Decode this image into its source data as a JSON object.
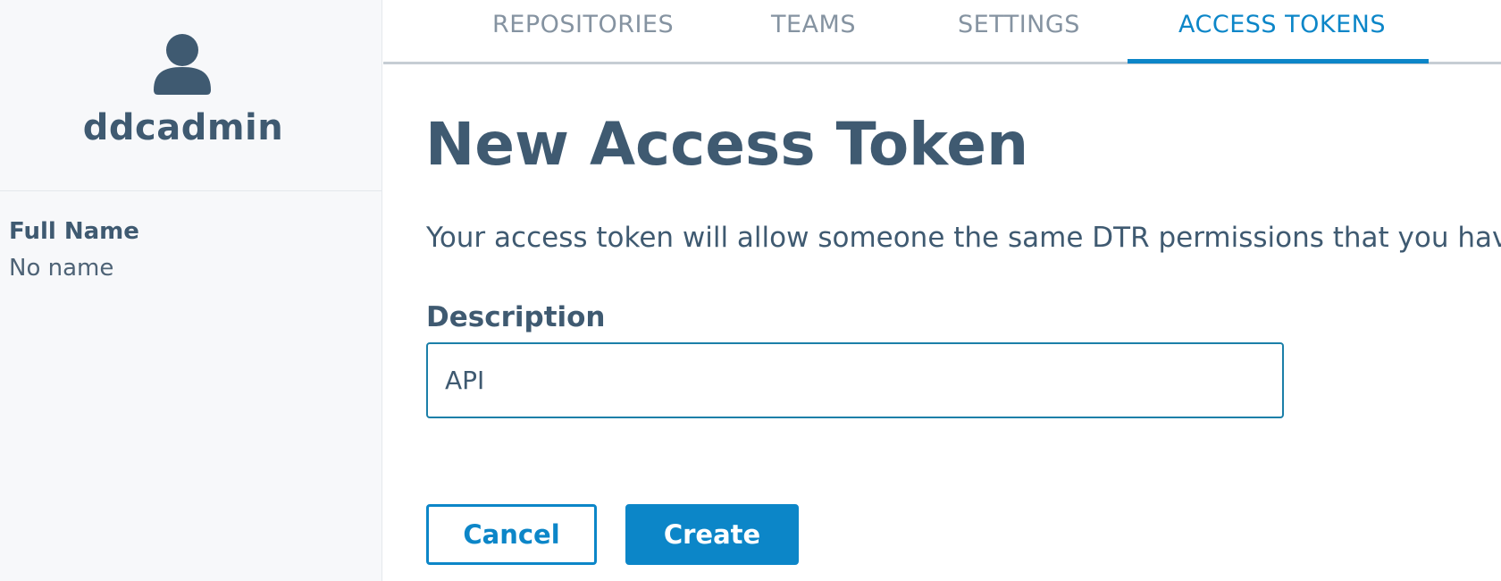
{
  "sidebar": {
    "avatar_icon": "user-icon",
    "username": "ddcadmin",
    "full_name_label": "Full Name",
    "full_name_value": "No name"
  },
  "tabs": [
    {
      "label": "REPOSITORIES",
      "active": false
    },
    {
      "label": "TEAMS",
      "active": false
    },
    {
      "label": "SETTINGS",
      "active": false
    },
    {
      "label": "ACCESS TOKENS",
      "active": true
    }
  ],
  "main": {
    "title": "New Access Token",
    "description": "Your access token will allow someone the same DTR permissions that you have.",
    "field_label": "Description",
    "field_value": "API"
  },
  "actions": {
    "cancel_label": "Cancel",
    "create_label": "Create"
  },
  "colors": {
    "accent": "#0c86c8",
    "text": "#3f5a71",
    "tab_inactive": "#8593a1",
    "sidebar_bg": "#f7f8fa"
  }
}
